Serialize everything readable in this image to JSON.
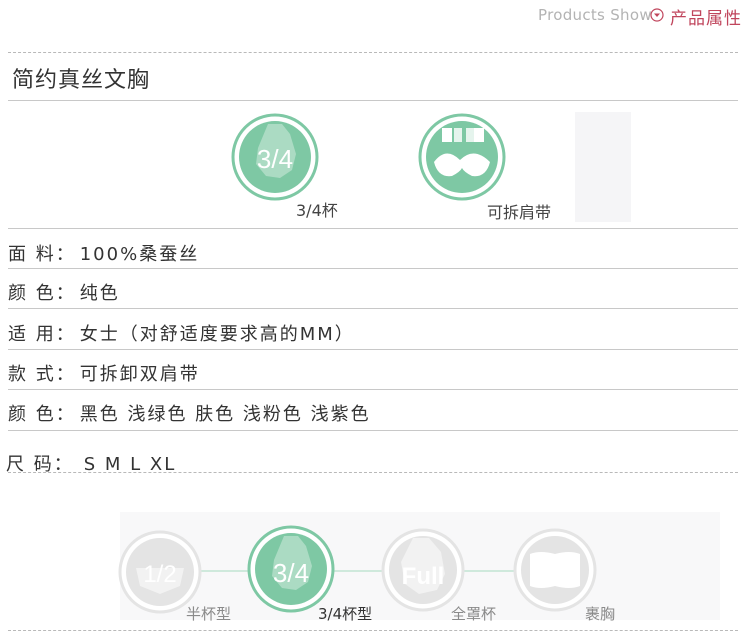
{
  "header": {
    "products_show": "Products Show",
    "section_title": "产品属性"
  },
  "product": {
    "title": "简约真丝文胸"
  },
  "features": [
    {
      "icon": "three-quarter-cup-icon",
      "badge": "3/4",
      "label": "3/4杯"
    },
    {
      "icon": "detachable-strap-icon",
      "label": "可拆肩带"
    }
  ],
  "attributes": [
    {
      "key": "面 料：",
      "value": "100%桑蚕丝"
    },
    {
      "key": "颜 色：",
      "value": "纯色"
    },
    {
      "key": "适 用：",
      "value": "女士（对舒适度要求高的MM）"
    },
    {
      "key": "款 式：",
      "value": "可拆卸双肩带"
    },
    {
      "key": "颜 色：",
      "value": "黑色  浅绿色  肤色  浅粉色  浅紫色"
    },
    {
      "key": "尺 码：",
      "value": "S   M   L   XL"
    }
  ],
  "cup_types": [
    {
      "badge": "1/2",
      "label": "半杯型",
      "active": false
    },
    {
      "badge": "3/4",
      "label": "3/4杯型",
      "active": true
    },
    {
      "badge": "Full",
      "label": "全罩杯",
      "active": false
    },
    {
      "badge": "",
      "label": "裹胸",
      "active": false
    }
  ],
  "colors": {
    "accent_green": "#7ec8a4",
    "accent_red": "#c0455c",
    "inactive_gray": "#e4e4e4"
  }
}
